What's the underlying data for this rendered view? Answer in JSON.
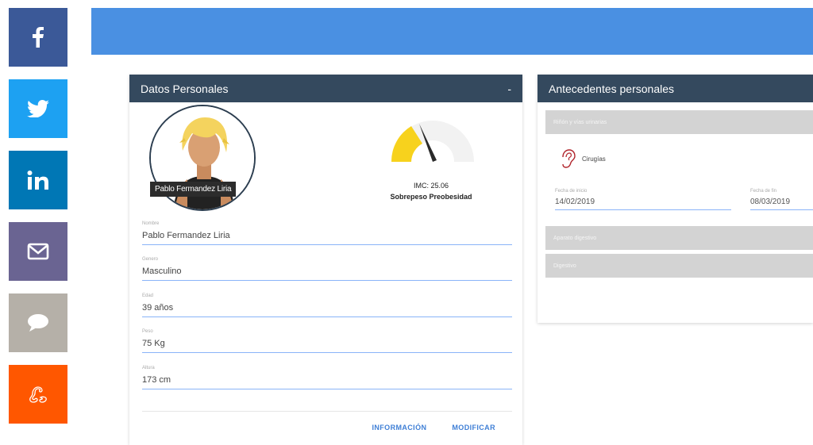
{
  "social": [
    {
      "icon": "facebook-icon",
      "color": "#3b5998"
    },
    {
      "icon": "twitter-icon",
      "color": "#1da1f2"
    },
    {
      "icon": "linkedin-icon",
      "color": "#0077b5"
    },
    {
      "icon": "mail-icon",
      "color": "#6a6492"
    },
    {
      "icon": "comment-icon",
      "color": "#b5b0a8"
    },
    {
      "icon": "reddit-icon",
      "color": "#ff5700"
    }
  ],
  "topbar": {
    "color": "#4a90e2"
  },
  "datos": {
    "title": "Datos Personales",
    "collapse": "-",
    "avatar_name": "Pablo Fermandez Liria",
    "imc_line": "IMC: 25.06",
    "imc_category": "Sobrepeso Preobesidad",
    "gauge_value": 25.06,
    "fields": [
      {
        "label": "Nombre",
        "value": "Pablo Fermandez Liria"
      },
      {
        "label": "Genero",
        "value": "Masculino"
      },
      {
        "label": "Edad",
        "value": "39 años"
      },
      {
        "label": "Peso",
        "value": "75 Kg"
      },
      {
        "label": "Altura",
        "value": "173 cm"
      }
    ],
    "actions": {
      "info": "INFORMACIÓN",
      "modify": "MODIFICAR"
    }
  },
  "antecedentes": {
    "title": "Antecedentes personales",
    "sections": [
      "Riñón y vías urinarias",
      "Aparato digestivo",
      "Digestivo"
    ],
    "item": {
      "label": "Cirugías",
      "icon": "ear-icon"
    },
    "date_from": {
      "label": "Fecha de inicio",
      "value": "14/02/2019"
    },
    "date_to": {
      "label": "Fecha de fin",
      "value": "08/03/2019"
    }
  }
}
